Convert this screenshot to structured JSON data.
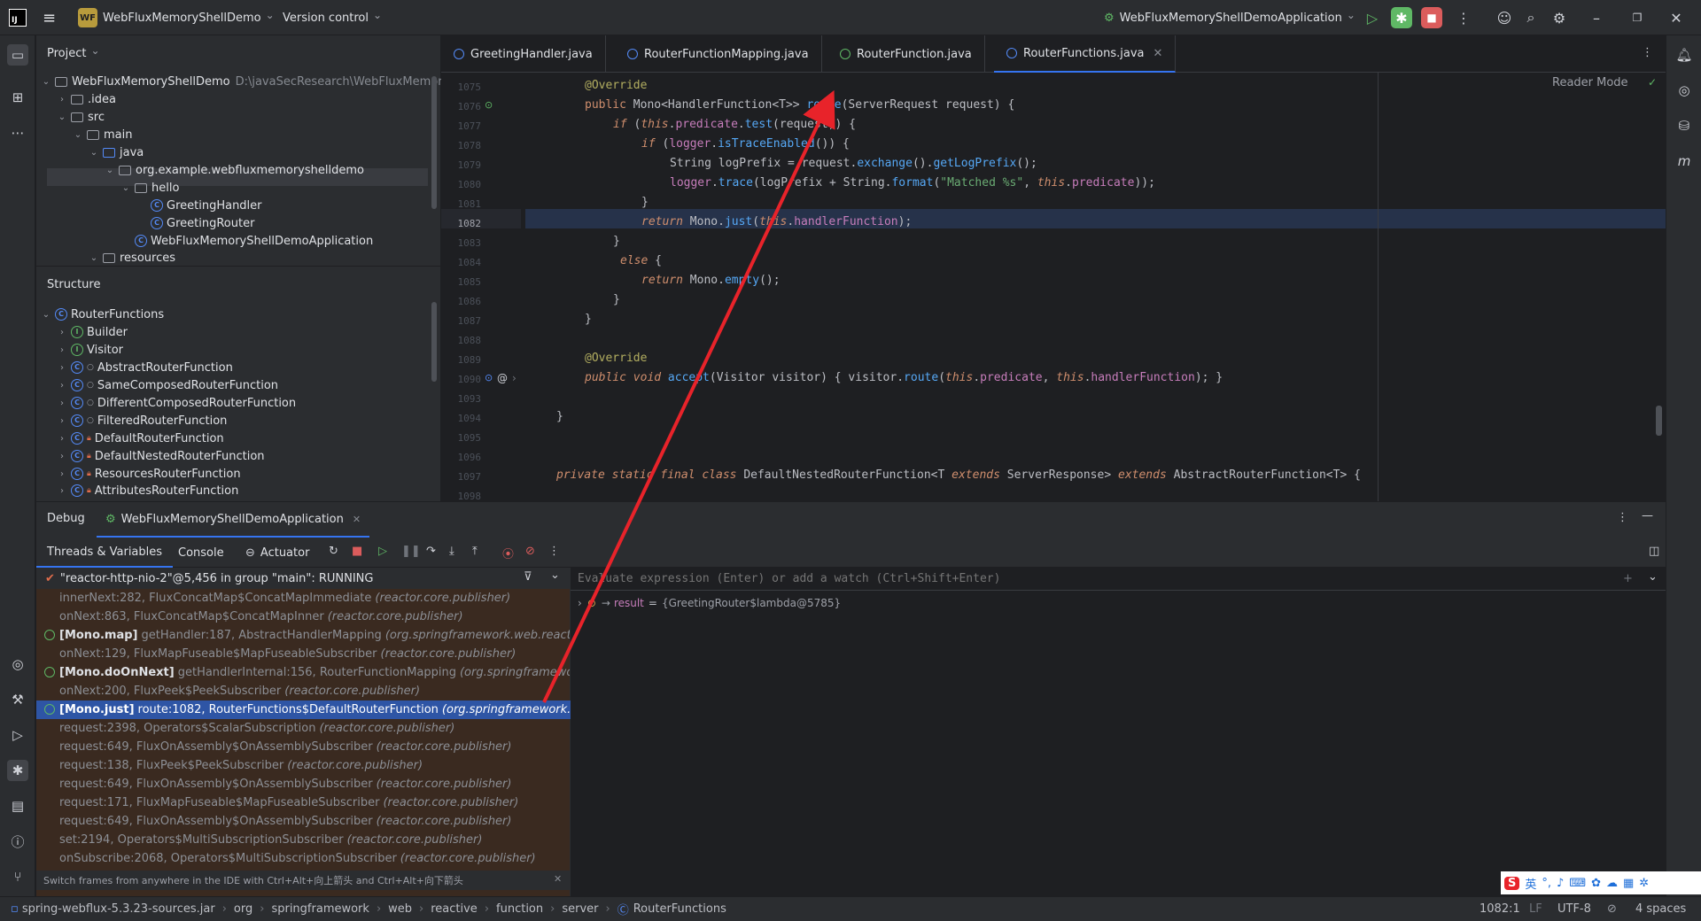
{
  "titlebar": {
    "app_icon": "intellij-logo",
    "project_badge": "WF",
    "project_name": "WebFluxMemoryShellDemo",
    "vcs": "Version control",
    "run_config": "WebFluxMemoryShellDemoApplication"
  },
  "project_panel": {
    "title": "Project",
    "tree": [
      {
        "label": "WebFluxMemoryShellDemo",
        "extra": "D:\\javaSecResearch\\WebFluxMemory",
        "kind": "module",
        "depth": 0,
        "open": true
      },
      {
        "label": ".idea",
        "kind": "folder",
        "depth": 1,
        "open": false
      },
      {
        "label": "src",
        "kind": "folder",
        "depth": 1,
        "open": true
      },
      {
        "label": "main",
        "kind": "folder",
        "depth": 2,
        "open": true
      },
      {
        "label": "java",
        "kind": "folder",
        "depth": 3,
        "open": true
      },
      {
        "label": "org.example.webfluxmemoryshelldemo",
        "kind": "folder",
        "depth": 4,
        "open": true
      },
      {
        "label": "hello",
        "kind": "folder",
        "depth": 5,
        "open": true
      },
      {
        "label": "GreetingHandler",
        "kind": "class",
        "depth": 6,
        "selected": true
      },
      {
        "label": "GreetingRouter",
        "kind": "class",
        "depth": 6
      },
      {
        "label": "WebFluxMemoryShellDemoApplication",
        "kind": "class",
        "depth": 5
      },
      {
        "label": "resources",
        "kind": "folder",
        "depth": 3,
        "open": true
      }
    ]
  },
  "structure_panel": {
    "title": "Structure",
    "tree": [
      {
        "label": "RouterFunctions",
        "kind": "class",
        "depth": 0,
        "open": true
      },
      {
        "label": "Builder",
        "kind": "iface",
        "depth": 1
      },
      {
        "label": "Visitor",
        "kind": "iface",
        "depth": 1
      },
      {
        "label": "AbstractRouterFunction",
        "kind": "class",
        "depth": 1,
        "mod": "circ"
      },
      {
        "label": "SameComposedRouterFunction",
        "kind": "class",
        "depth": 1,
        "mod": "circ"
      },
      {
        "label": "DifferentComposedRouterFunction",
        "kind": "class",
        "depth": 1,
        "mod": "circ"
      },
      {
        "label": "FilteredRouterFunction",
        "kind": "class",
        "depth": 1,
        "mod": "circ"
      },
      {
        "label": "DefaultRouterFunction",
        "kind": "class",
        "depth": 1,
        "mod": "lock"
      },
      {
        "label": "DefaultNestedRouterFunction",
        "kind": "class",
        "depth": 1,
        "mod": "lock"
      },
      {
        "label": "ResourcesRouterFunction",
        "kind": "class",
        "depth": 1,
        "mod": "lock"
      },
      {
        "label": "AttributesRouterFunction",
        "kind": "class",
        "depth": 1,
        "mod": "lock"
      }
    ]
  },
  "editor": {
    "tabs": [
      {
        "label": "GreetingHandler.java",
        "icon": "class"
      },
      {
        "label": "RouterFunctionMapping.java",
        "icon": "class"
      },
      {
        "label": "RouterFunction.java",
        "icon": "interface"
      },
      {
        "label": "RouterFunctions.java",
        "icon": "class",
        "active": true
      }
    ],
    "reader_mode": "Reader Mode",
    "current_line": "1082",
    "line_numbers": [
      "1075",
      "1076",
      "1077",
      "1078",
      "1079",
      "1080",
      "1081",
      "1082",
      "1083",
      "1084",
      "1085",
      "1086",
      "1087",
      "1088",
      "1089",
      "1090",
      "1093",
      "1094",
      "1095",
      "1096",
      "1097",
      "1098"
    ]
  },
  "debug": {
    "title": "Debug",
    "session": "WebFluxMemoryShellDemoApplication",
    "tabs": [
      "Threads & Variables",
      "Console",
      "Actuator"
    ],
    "thread": "\"reactor-http-nio-2\"@5,456 in group \"main\": RUNNING",
    "watch_placeholder": "Evaluate expression (Enter) or add a watch (Ctrl+Shift+Enter)",
    "result_var": "result",
    "result_value": "{GreetingRouter$lambda@5785}",
    "frames": [
      {
        "text": "innerNext:282, FluxConcatMap$ConcatMapImmediate",
        "pkg": "(reactor.core.publisher)"
      },
      {
        "text": "onNext:863, FluxConcatMap$ConcatMapInner",
        "pkg": "(reactor.core.publisher)"
      },
      {
        "tag": "[Mono.map]",
        "text": "getHandler:187, AbstractHandlerMapping",
        "pkg": "(org.springframework.web.reactive.h",
        "bold": true
      },
      {
        "text": "onNext:129, FluxMapFuseable$MapFuseableSubscriber",
        "pkg": "(reactor.core.publisher)"
      },
      {
        "tag": "[Mono.doOnNext]",
        "text": "getHandlerInternal:156, RouterFunctionMapping",
        "pkg": "(org.springframework.w",
        "bold": true
      },
      {
        "text": "onNext:200, FluxPeek$PeekSubscriber",
        "pkg": "(reactor.core.publisher)"
      },
      {
        "tag": "[Mono.just]",
        "text": "route:1082, RouterFunctions$DefaultRouterFunction",
        "pkg": "(org.springframework.web.reactive.function.server)",
        "selected": true
      },
      {
        "text": "request:2398, Operators$ScalarSubscription",
        "pkg": "(reactor.core.publisher)"
      },
      {
        "text": "request:649, FluxOnAssembly$OnAssemblySubscriber",
        "pkg": "(reactor.core.publisher)"
      },
      {
        "text": "request:138, FluxPeek$PeekSubscriber",
        "pkg": "(reactor.core.publisher)"
      },
      {
        "text": "request:649, FluxOnAssembly$OnAssemblySubscriber",
        "pkg": "(reactor.core.publisher)"
      },
      {
        "text": "request:171, FluxMapFuseable$MapFuseableSubscriber",
        "pkg": "(reactor.core.publisher)"
      },
      {
        "text": "request:649, FluxOnAssembly$OnAssemblySubscriber",
        "pkg": "(reactor.core.publisher)"
      },
      {
        "text": "set:2194, Operators$MultiSubscriptionSubscriber",
        "pkg": "(reactor.core.publisher)"
      },
      {
        "text": "onSubscribe:2068, Operators$MultiSubscriptionSubscriber",
        "pkg": "(reactor.core.publisher)"
      }
    ],
    "hint": "Switch frames from anywhere in the IDE with Ctrl+Alt+向上箭头 and Ctrl+Alt+向下箭头"
  },
  "statusbar": {
    "breadcrumbs": [
      "spring-webflux-5.3.23-sources.jar",
      "org",
      "springframework",
      "web",
      "reactive",
      "function",
      "server",
      "RouterFunctions"
    ],
    "position": "1082:1",
    "line_sep": "LF",
    "encoding": "UTF-8",
    "indent": "4 spaces",
    "ime": [
      "英"
    ]
  },
  "colors": {
    "accent": "#3574f0",
    "selection": "#2e55a5",
    "annotation_arrow": "#e8232a",
    "stop_button": "#db5c5c",
    "debug_active": "#5fb865"
  }
}
